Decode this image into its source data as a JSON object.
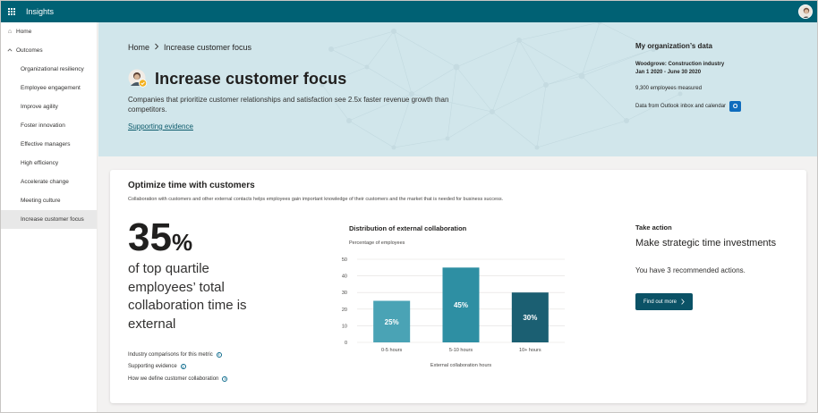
{
  "app": {
    "title": "Insights"
  },
  "sidebar": {
    "home": "Home",
    "outcomes": "Outcomes",
    "items": [
      "Organizational resiliency",
      "Employee engagement",
      "Improve agility",
      "Foster innovation",
      "Effective managers",
      "High efficiency",
      "Accelerate change",
      "Meeting culture",
      "Increase customer focus"
    ]
  },
  "hero": {
    "breadcrumb_home": "Home",
    "breadcrumb_current": "Increase customer focus",
    "title": "Increase customer focus",
    "description": "Companies that prioritize customer relationships and satisfaction see 2.5x faster revenue growth than competitors.",
    "link": "Supporting evidence"
  },
  "org": {
    "heading": "My organization’s data",
    "company": "Woodgrove:  Construction industry",
    "dates": "Jan 1 2020 - June 30 2020",
    "employees": "9,300 employees measured",
    "source": "Data from Outlook inbox and calendar"
  },
  "card": {
    "title": "Optimize time with customers",
    "description": "Collaboration with customers and other external contacts helps employees gain important knowledge of their customers and the market that is needed for business success.",
    "big_value": "35",
    "big_unit": "%",
    "big_text": "of top quartile employees’ total collaboration time is external",
    "links": [
      "Industry comparisons for this metric",
      "Supporting evidence",
      "How we define customer collaboration"
    ]
  },
  "chart": {
    "title": "Distribution of external collaboration",
    "ylabel": "Percentage of employees"
  },
  "chart_data": {
    "type": "bar",
    "categories": [
      "0-5 hours",
      "5-10 hours",
      "10+ hours"
    ],
    "values": [
      25,
      45,
      30
    ],
    "data_labels": [
      "25%",
      "45%",
      "30%"
    ],
    "colors": [
      "#4aa3b5",
      "#2e8fa3",
      "#1b5f72"
    ],
    "xlabel": "External collaboration hours",
    "ylabel": "Percentage of employees",
    "yticks": [
      0,
      10,
      20,
      30,
      40,
      50
    ],
    "ylim": [
      0,
      50
    ],
    "grid": true
  },
  "action": {
    "label": "Take action",
    "heading": "Make strategic time investments",
    "recommend": "You have 3 recommended actions.",
    "button": "Find out more"
  },
  "colors": {
    "topbar": "#006174",
    "hero_bg": "#d1e6eb",
    "button": "#0b5266"
  }
}
